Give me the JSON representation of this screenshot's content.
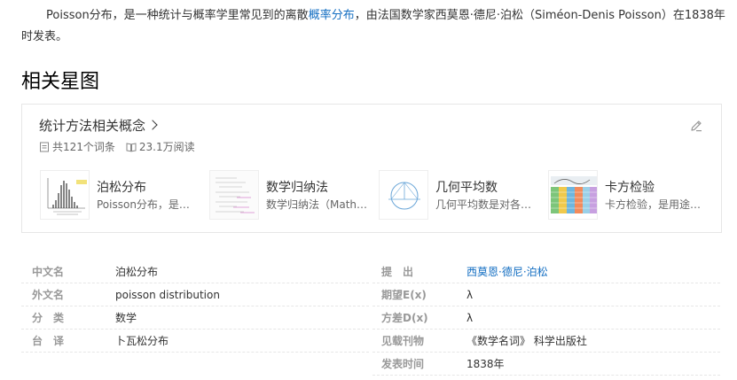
{
  "intro": {
    "text_before": "Poisson分布，是一种统计与概率学里常见到的离散",
    "link": "概率分布",
    "text_after": "，由法国数学家西莫恩·德尼·泊松（Siméon-Denis Poisson）在1838年时发表。"
  },
  "section_title": "相关星图",
  "card": {
    "title": "统计方法相关概念",
    "count": "共121个词条",
    "views": "23.1万阅读",
    "items": [
      {
        "name": "泊松分布",
        "desc": "Poisson分布，是…"
      },
      {
        "name": "数学归纳法",
        "desc": "数学归纳法（Math…"
      },
      {
        "name": "几何平均数",
        "desc": "几何平均数是对各…"
      },
      {
        "name": "卡方检验",
        "desc": "卡方检验，是用途…"
      }
    ]
  },
  "basic_info": {
    "left": [
      {
        "key": "中文名",
        "value": "泊松分布"
      },
      {
        "key": "外文名",
        "value": "poisson distribution"
      },
      {
        "key": "分　类",
        "value": "数学"
      },
      {
        "key": "台　译",
        "value": "卜瓦松分布"
      }
    ],
    "right": [
      {
        "key": "提　出",
        "value": "西莫恩·德尼·泊松"
      },
      {
        "key": "期望E(x)",
        "value": "λ"
      },
      {
        "key": "方差D(x)",
        "value": "λ"
      },
      {
        "key": "见载刊物",
        "value": "《数学名词》 科学出版社"
      },
      {
        "key": "发表时间",
        "value": "1838年"
      }
    ]
  },
  "colors": {
    "link": "#136ec2",
    "border": "#e6e6e6",
    "key_text": "#999999"
  }
}
